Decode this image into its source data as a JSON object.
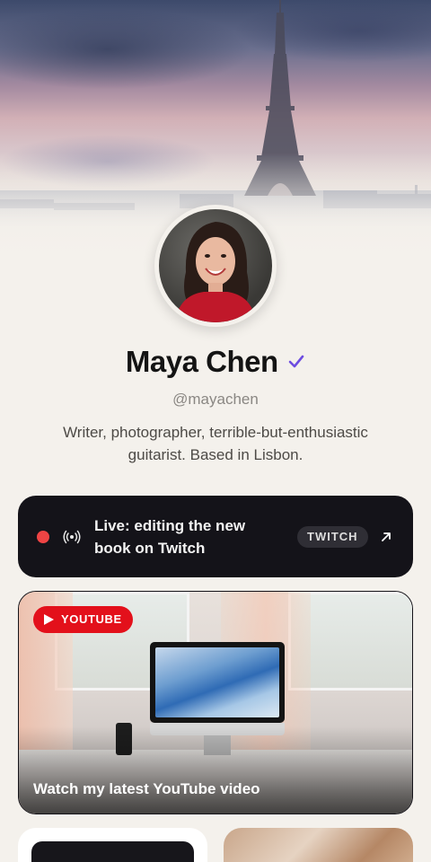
{
  "profile": {
    "name": "Maya Chen",
    "verified_icon": "verified-check-icon",
    "handle": "@mayachen",
    "bio": "Writer, photographer, terrible-but-enthusiastic guitarist. Based in Lisbon."
  },
  "live_card": {
    "text": "Live: editing the new book on Twitch",
    "badge": "TWITCH",
    "status_color": "#ef4444",
    "icons": [
      "live-dot-icon",
      "broadcast-icon",
      "external-link-arrow-icon"
    ]
  },
  "youtube_card": {
    "badge": "YOUTUBE",
    "title": "Watch my latest YouTube video",
    "badge_color": "#e3101b",
    "icon": "play-icon"
  },
  "colors": {
    "background": "#f4f1ec",
    "card_dark": "#141319",
    "accent_verified": "#6d4de0"
  }
}
